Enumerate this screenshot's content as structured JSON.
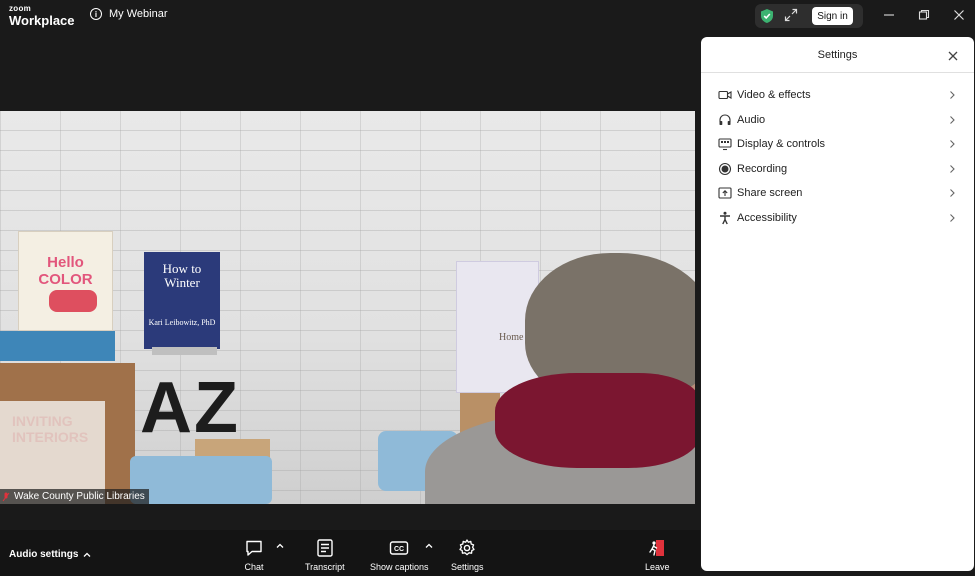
{
  "titlebar": {
    "logo_line1": "zoom",
    "logo_line2": "Workplace",
    "meeting_title": "My Webinar",
    "sign_in_label": "Sign in"
  },
  "video": {
    "participant_name": "Wake County Public Libraries",
    "scene_text": {
      "book1_title": "Hello COLOR",
      "book2_title": "How to Winter",
      "book2_author": "Kari Leibowitz, PhD",
      "letters": "AZ",
      "book3_title": "INVITING INTERIORS",
      "book4_title": "Home"
    }
  },
  "settings_panel": {
    "title": "Settings",
    "items": [
      {
        "label": "Video & effects",
        "icon": "video-camera-icon"
      },
      {
        "label": "Audio",
        "icon": "headphones-icon"
      },
      {
        "label": "Display & controls",
        "icon": "display-controls-icon"
      },
      {
        "label": "Recording",
        "icon": "record-icon"
      },
      {
        "label": "Share screen",
        "icon": "share-screen-icon"
      },
      {
        "label": "Accessibility",
        "icon": "accessibility-icon"
      }
    ]
  },
  "toolbar": {
    "audio_settings_label": "Audio settings",
    "chat_label": "Chat",
    "transcript_label": "Transcript",
    "captions_label": "Show captions",
    "settings_label": "Settings",
    "leave_label": "Leave"
  },
  "colors": {
    "background": "#1a1a1a",
    "panel": "#ffffff",
    "shield_green": "#3cb371",
    "leave_red": "#e0323c"
  }
}
